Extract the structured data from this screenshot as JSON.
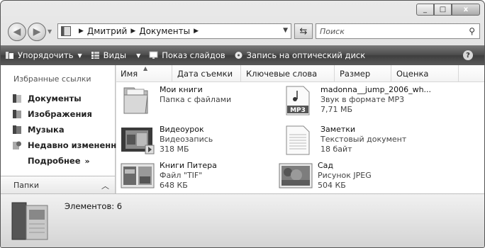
{
  "window": {
    "caption_buttons": [
      "_",
      "□",
      "x"
    ]
  },
  "nav": {
    "breadcrumbs": [
      "Дмитрий",
      "Документы"
    ],
    "search_placeholder": "Поиск"
  },
  "toolbar": {
    "organize": "Упорядочить",
    "views": "Виды",
    "slideshow": "Показ слайдов",
    "burn": "Запись на оптический диск",
    "help": "?"
  },
  "sidebar": {
    "favorites_title": "Избранные ссылки",
    "items": [
      {
        "label": "Документы",
        "icon": "documents-icon"
      },
      {
        "label": "Изображения",
        "icon": "pictures-icon"
      },
      {
        "label": "Музыка",
        "icon": "music-icon"
      },
      {
        "label": "Недавно измененн...",
        "icon": "recent-icon"
      }
    ],
    "more": "Подробнее",
    "more_glyph": "»",
    "folders": "Папки"
  },
  "columns": [
    "Имя",
    "Дата съемки",
    "Ключевые слова",
    "Размер",
    "Оценка"
  ],
  "files": [
    {
      "name": "Мои книги",
      "type": "Папка с файлами",
      "size": "",
      "icon": "folder-icon"
    },
    {
      "name": "madonna__jump_2006_wh...",
      "type": "Звук в формате MP3",
      "size": "7,71 МБ",
      "icon": "mp3-icon"
    },
    {
      "name": "Видеоурок",
      "type": "Видеозапись",
      "size": "318 МБ",
      "icon": "video-icon"
    },
    {
      "name": "Заметки",
      "type": "Текстовый документ",
      "size": "18 байт",
      "icon": "text-document-icon"
    },
    {
      "name": "Книги Питера",
      "type": "Файл \"TIF\"",
      "size": "648 КБ",
      "icon": "tif-image-icon"
    },
    {
      "name": "Сад",
      "type": "Рисунок JPEG",
      "size": "504 КБ",
      "icon": "jpeg-image-icon"
    }
  ],
  "mp3_badge": "MP3",
  "details": {
    "label": "Элементов:",
    "count": "6"
  }
}
